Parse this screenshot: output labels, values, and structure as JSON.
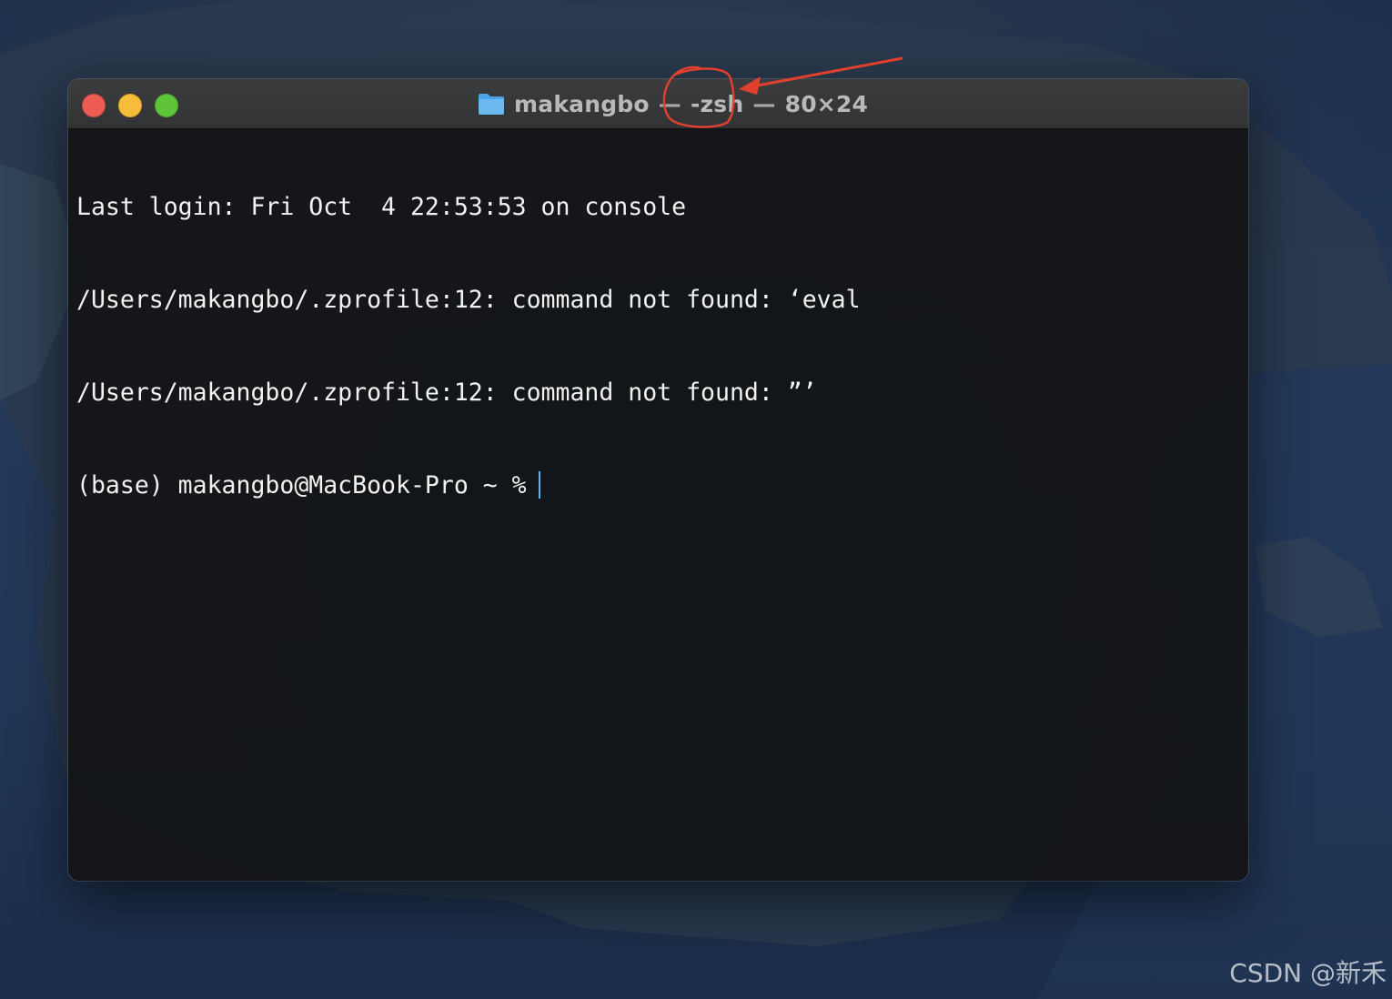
{
  "window": {
    "title": {
      "folder_icon": "folder-icon",
      "name": "makangbo",
      "separator": "—",
      "shell": "-zsh",
      "size": "80×24"
    }
  },
  "terminal": {
    "lines": [
      "Last login: Fri Oct  4 22:53:53 on console",
      "/Users/makangbo/.zprofile:12: command not found: ‘eval",
      "/Users/makangbo/.zprofile:12: command not found: ”’",
      "(base) makangbo@MacBook-Pro ~ %"
    ]
  },
  "annotation": {
    "color": "#e0402e",
    "target": "-zsh"
  },
  "watermark": "CSDN @新禾"
}
